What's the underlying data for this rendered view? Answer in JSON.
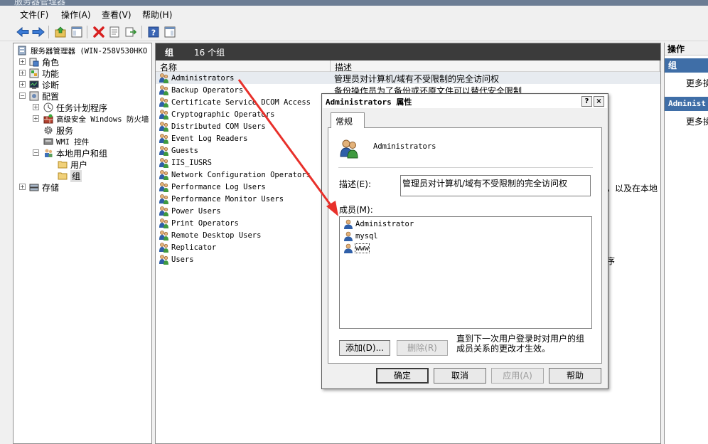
{
  "window": {
    "title": "服务器管理器"
  },
  "menu": [
    {
      "label": "文件(F)"
    },
    {
      "label": "操作(A)"
    },
    {
      "label": "查看(V)"
    },
    {
      "label": "帮助(H)"
    }
  ],
  "toolbar_icons": [
    "back-icon",
    "forward-icon",
    "up-folder-icon",
    "show-tree-icon",
    "delete-icon",
    "properties-icon",
    "export-icon",
    "help-icon",
    "view-icon"
  ],
  "tree": {
    "root": "服务器管理器 (WIN-258V530HKO",
    "items": [
      {
        "label": "角色"
      },
      {
        "label": "功能"
      },
      {
        "label": "诊断"
      },
      {
        "label": "配置"
      },
      {
        "label": "任务计划程序"
      },
      {
        "label": "高级安全 Windows 防火墙"
      },
      {
        "label": "服务"
      },
      {
        "label": "WMI 控件"
      },
      {
        "label": "本地用户和组"
      },
      {
        "label": "用户"
      },
      {
        "label": "组"
      },
      {
        "label": "存储"
      }
    ]
  },
  "center": {
    "header_title": "组",
    "header_count": "16 个组",
    "col_name": "名称",
    "col_desc": "描述",
    "groups": [
      {
        "name": "Administrators",
        "desc": "管理员对计算机/域有不受限制的完全访问权"
      },
      {
        "name": "Backup Operators",
        "desc": "备份操作员为了备份或还原文件可以替代安全限制"
      },
      {
        "name": "Certificate Service DCOM Access",
        "desc": ""
      },
      {
        "name": "Cryptographic Operators",
        "desc": ""
      },
      {
        "name": "Distributed COM Users",
        "desc": ""
      },
      {
        "name": "Event Log Readers",
        "desc": ""
      },
      {
        "name": "Guests",
        "desc": ""
      },
      {
        "name": "IIS_IUSRS",
        "desc": ""
      },
      {
        "name": "Network Configuration Operators",
        "desc": ""
      },
      {
        "name": "Performance Log Users",
        "desc": ""
      },
      {
        "name": "Performance Monitor Users",
        "desc": ""
      },
      {
        "name": "Power Users",
        "desc": ""
      },
      {
        "name": "Print Operators",
        "desc": ""
      },
      {
        "name": "Remote Desktop Users",
        "desc": ""
      },
      {
        "name": "Replicator",
        "desc": ""
      },
      {
        "name": "Users",
        "desc": ""
      }
    ],
    "overflow_1": "，以及在本地",
    "overflow_2": "序"
  },
  "actions": {
    "header": "操作",
    "section1": "组",
    "section1_more": "更多操",
    "section2": "Administ",
    "section2_more": "更多操"
  },
  "dialog": {
    "title": "Administrators 属性",
    "help_btn": "?",
    "close_btn": "×",
    "tab": "常规",
    "group_name": "Administrators",
    "desc_label": "描述(E):",
    "desc_value": "管理员对计算机/域有不受限制的完全访问权",
    "members_label": "成员(M):",
    "members": [
      "Administrator",
      "mysql",
      "www"
    ],
    "add_btn": "添加(D)...",
    "remove_btn": "删除(R)",
    "note": "直到下一次用户登录时对用户的组成员关系的更改才生效。",
    "ok_btn": "确定",
    "cancel_btn": "取消",
    "apply_btn": "应用(A)",
    "help_action_btn": "帮助"
  },
  "colors": {
    "dark_header": "#3b3b3b",
    "action_blue": "#3f6ea7",
    "annotation_red": "#e8302a"
  }
}
